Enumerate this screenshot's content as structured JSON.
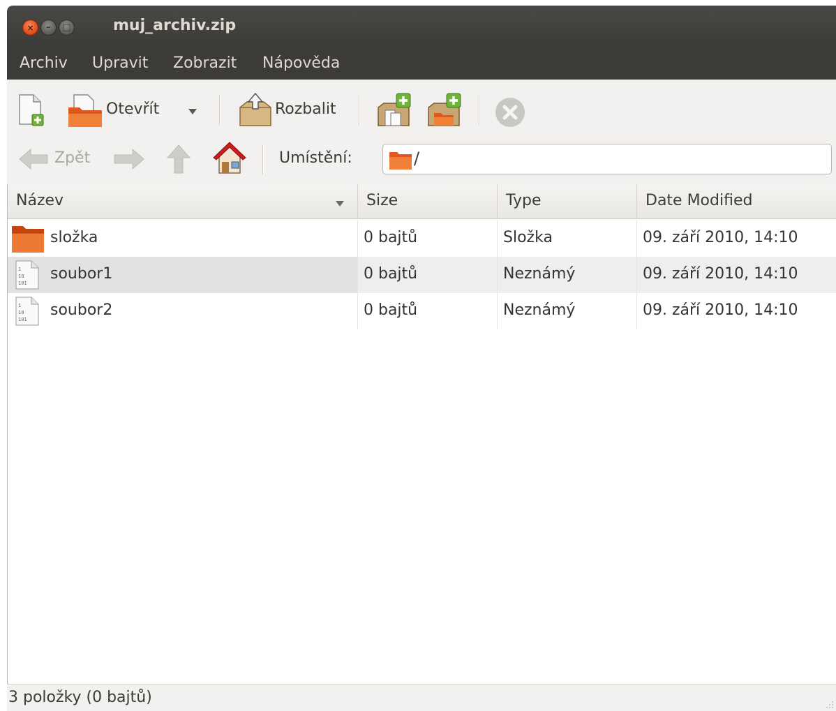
{
  "window": {
    "title": "muj_archiv.zip",
    "controls": {
      "close": "×",
      "minimize": "–",
      "maximize": "□"
    }
  },
  "menubar": {
    "items": [
      {
        "label": "Archiv"
      },
      {
        "label": "Upravit"
      },
      {
        "label": "Zobrazit"
      },
      {
        "label": "Nápověda"
      }
    ]
  },
  "toolbar": {
    "new_icon": "new-archive-icon",
    "open_label": "Otevřít",
    "open_icon": "open-archive-icon",
    "extract_label": "Rozbalit",
    "extract_icon": "extract-icon",
    "add_files_icon": "add-files-icon",
    "add_folder_icon": "add-folder-icon",
    "stop_icon": "stop-icon"
  },
  "navigation": {
    "back_label": "Zpět",
    "location_label": "Umístění:",
    "location_value": "/"
  },
  "table": {
    "columns": [
      {
        "label": "Název",
        "sort": "descending"
      },
      {
        "label": "Size"
      },
      {
        "label": "Type"
      },
      {
        "label": "Date Modified"
      }
    ],
    "rows": [
      {
        "name": "složka",
        "size": "0 bajtů",
        "type": "Složka",
        "date": "09. září 2010, 14:10",
        "icon": "folder-icon"
      },
      {
        "name": "soubor1",
        "size": "0 bajtů",
        "type": "Neznámý",
        "date": "09. září 2010, 14:10",
        "icon": "binary-file-icon",
        "hover": true
      },
      {
        "name": "soubor2",
        "size": "0 bajtů",
        "type": "Neznámý",
        "date": "09. září 2010, 14:10",
        "icon": "binary-file-icon"
      }
    ]
  },
  "statusbar": {
    "text": "3 položky (0 bajtů)"
  },
  "colors": {
    "titlebar": "#3c3b37",
    "close_button": "#df4a16",
    "folder": "#e0581f",
    "hover_row": "#e4e4e4"
  }
}
